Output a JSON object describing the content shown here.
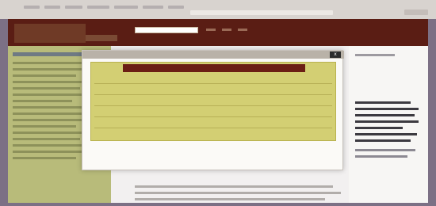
{
  "header": {
    "logo_text": "",
    "search_placeholder": ""
  },
  "dialog": {
    "title": "",
    "close_label": "x",
    "table_header": "",
    "rows": [
      {
        "c1": "",
        "c2": "",
        "c3": "",
        "c4": ""
      },
      {
        "c1": "",
        "c2": "",
        "c3": "",
        "c4": ""
      },
      {
        "c1": "",
        "c2": "",
        "c3": "",
        "c4": ""
      },
      {
        "c1": "",
        "c2": "",
        "c3": "",
        "c4": ""
      },
      {
        "c1": "",
        "c2": "",
        "c3": "",
        "c4": ""
      },
      {
        "c1": "",
        "c2": "",
        "c3": "",
        "c4": ""
      }
    ],
    "footnote": "",
    "footnote2": ""
  }
}
